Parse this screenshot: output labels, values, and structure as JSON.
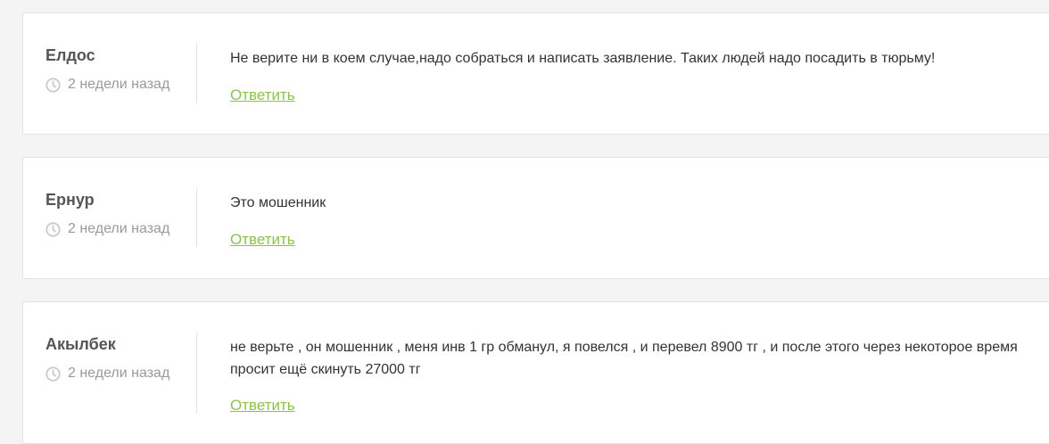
{
  "comments": [
    {
      "author": "Елдос",
      "time": "2 недели назад",
      "text": "Не верите ни в коем случае,надо собраться и написать заявление. Таких людей надо посадить в тюрьму!",
      "reply_label": "Ответить"
    },
    {
      "author": "Ернур",
      "time": "2 недели назад",
      "text": "Это мошенник",
      "reply_label": "Ответить"
    },
    {
      "author": "Акылбек",
      "time": "2 недели назад",
      "text": "не верьте , он мошенник , меня инв 1 гр обманул, я повелся , и перевел 8900 тг , и после этого через некоторое время просит ещё скинуть 27000 тг",
      "reply_label": "Ответить"
    }
  ],
  "icons": {
    "time": "clock-icon"
  },
  "colors": {
    "accent": "#8bc34a",
    "muted": "#9a9a9a",
    "author": "#555555",
    "text": "#333333",
    "page_bg": "#f4f4f4"
  }
}
